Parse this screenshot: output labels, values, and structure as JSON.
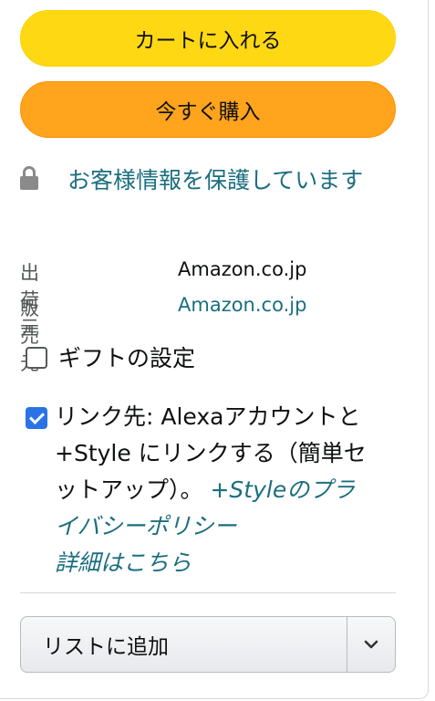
{
  "buy_box": {
    "add_to_cart_label": "カートに入れる",
    "buy_now_label": "今すぐ購入"
  },
  "secure": {
    "text": "お客様情報を保護しています"
  },
  "ships_from": {
    "label": "出荷元",
    "value": "Amazon.co.jp"
  },
  "sold_by": {
    "label": "販売元",
    "value": "Amazon.co.jp"
  },
  "gift": {
    "label": "ギフトの設定",
    "checked": false
  },
  "alexa": {
    "checked": true,
    "text": "リンク先: Alexaアカウントと +Style にリンクする（簡単セットアップ）。 ",
    "policy_link": "+Styleのプライバシーポリシー",
    "details_link": "詳細はこちら"
  },
  "add_to_list": {
    "label": "リストに追加"
  },
  "colors": {
    "cart_button": "#ffd814",
    "buy_button": "#ffa41c",
    "link": "#1b6e7f",
    "checkbox_checked": "#2973e6"
  }
}
